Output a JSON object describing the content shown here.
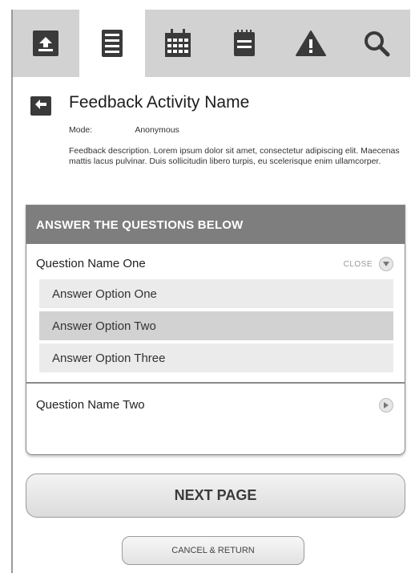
{
  "toolbar": {
    "icons": [
      "home-arrow-icon",
      "document-list-icon",
      "calendar-icon",
      "notepad-icon",
      "warning-icon",
      "search-icon"
    ],
    "active_index": 1
  },
  "header": {
    "title": "Feedback Activity Name",
    "mode_label": "Mode:",
    "mode_value": "Anonymous",
    "description": "Feedback description. Lorem ipsum dolor sit amet, consectetur adipiscing elit. Maecenas mattis lacus pulvinar. Duis sollicitudin libero turpis, eu scelerisque enim ullamcorper."
  },
  "panel": {
    "heading": "ANSWER THE QUESTIONS BELOW",
    "question_one": "Question Name One",
    "close_label": "CLOSE",
    "answers": [
      "Answer Option One",
      "Answer Option Two",
      "Answer Option Three"
    ],
    "selected_answer": "Answer Option Two",
    "question_two": "Question Name Two"
  },
  "actions": {
    "next_label": "NEXT PAGE",
    "cancel_label": "CANCEL & RETURN"
  },
  "colors": {
    "toolbar_bg": "#d2d2d2",
    "icon_dark": "#3a3a3a",
    "panel_header": "#7e7e7e",
    "answer_bg": "#ebebeb",
    "answer_selected_bg": "#d2d2d2"
  }
}
